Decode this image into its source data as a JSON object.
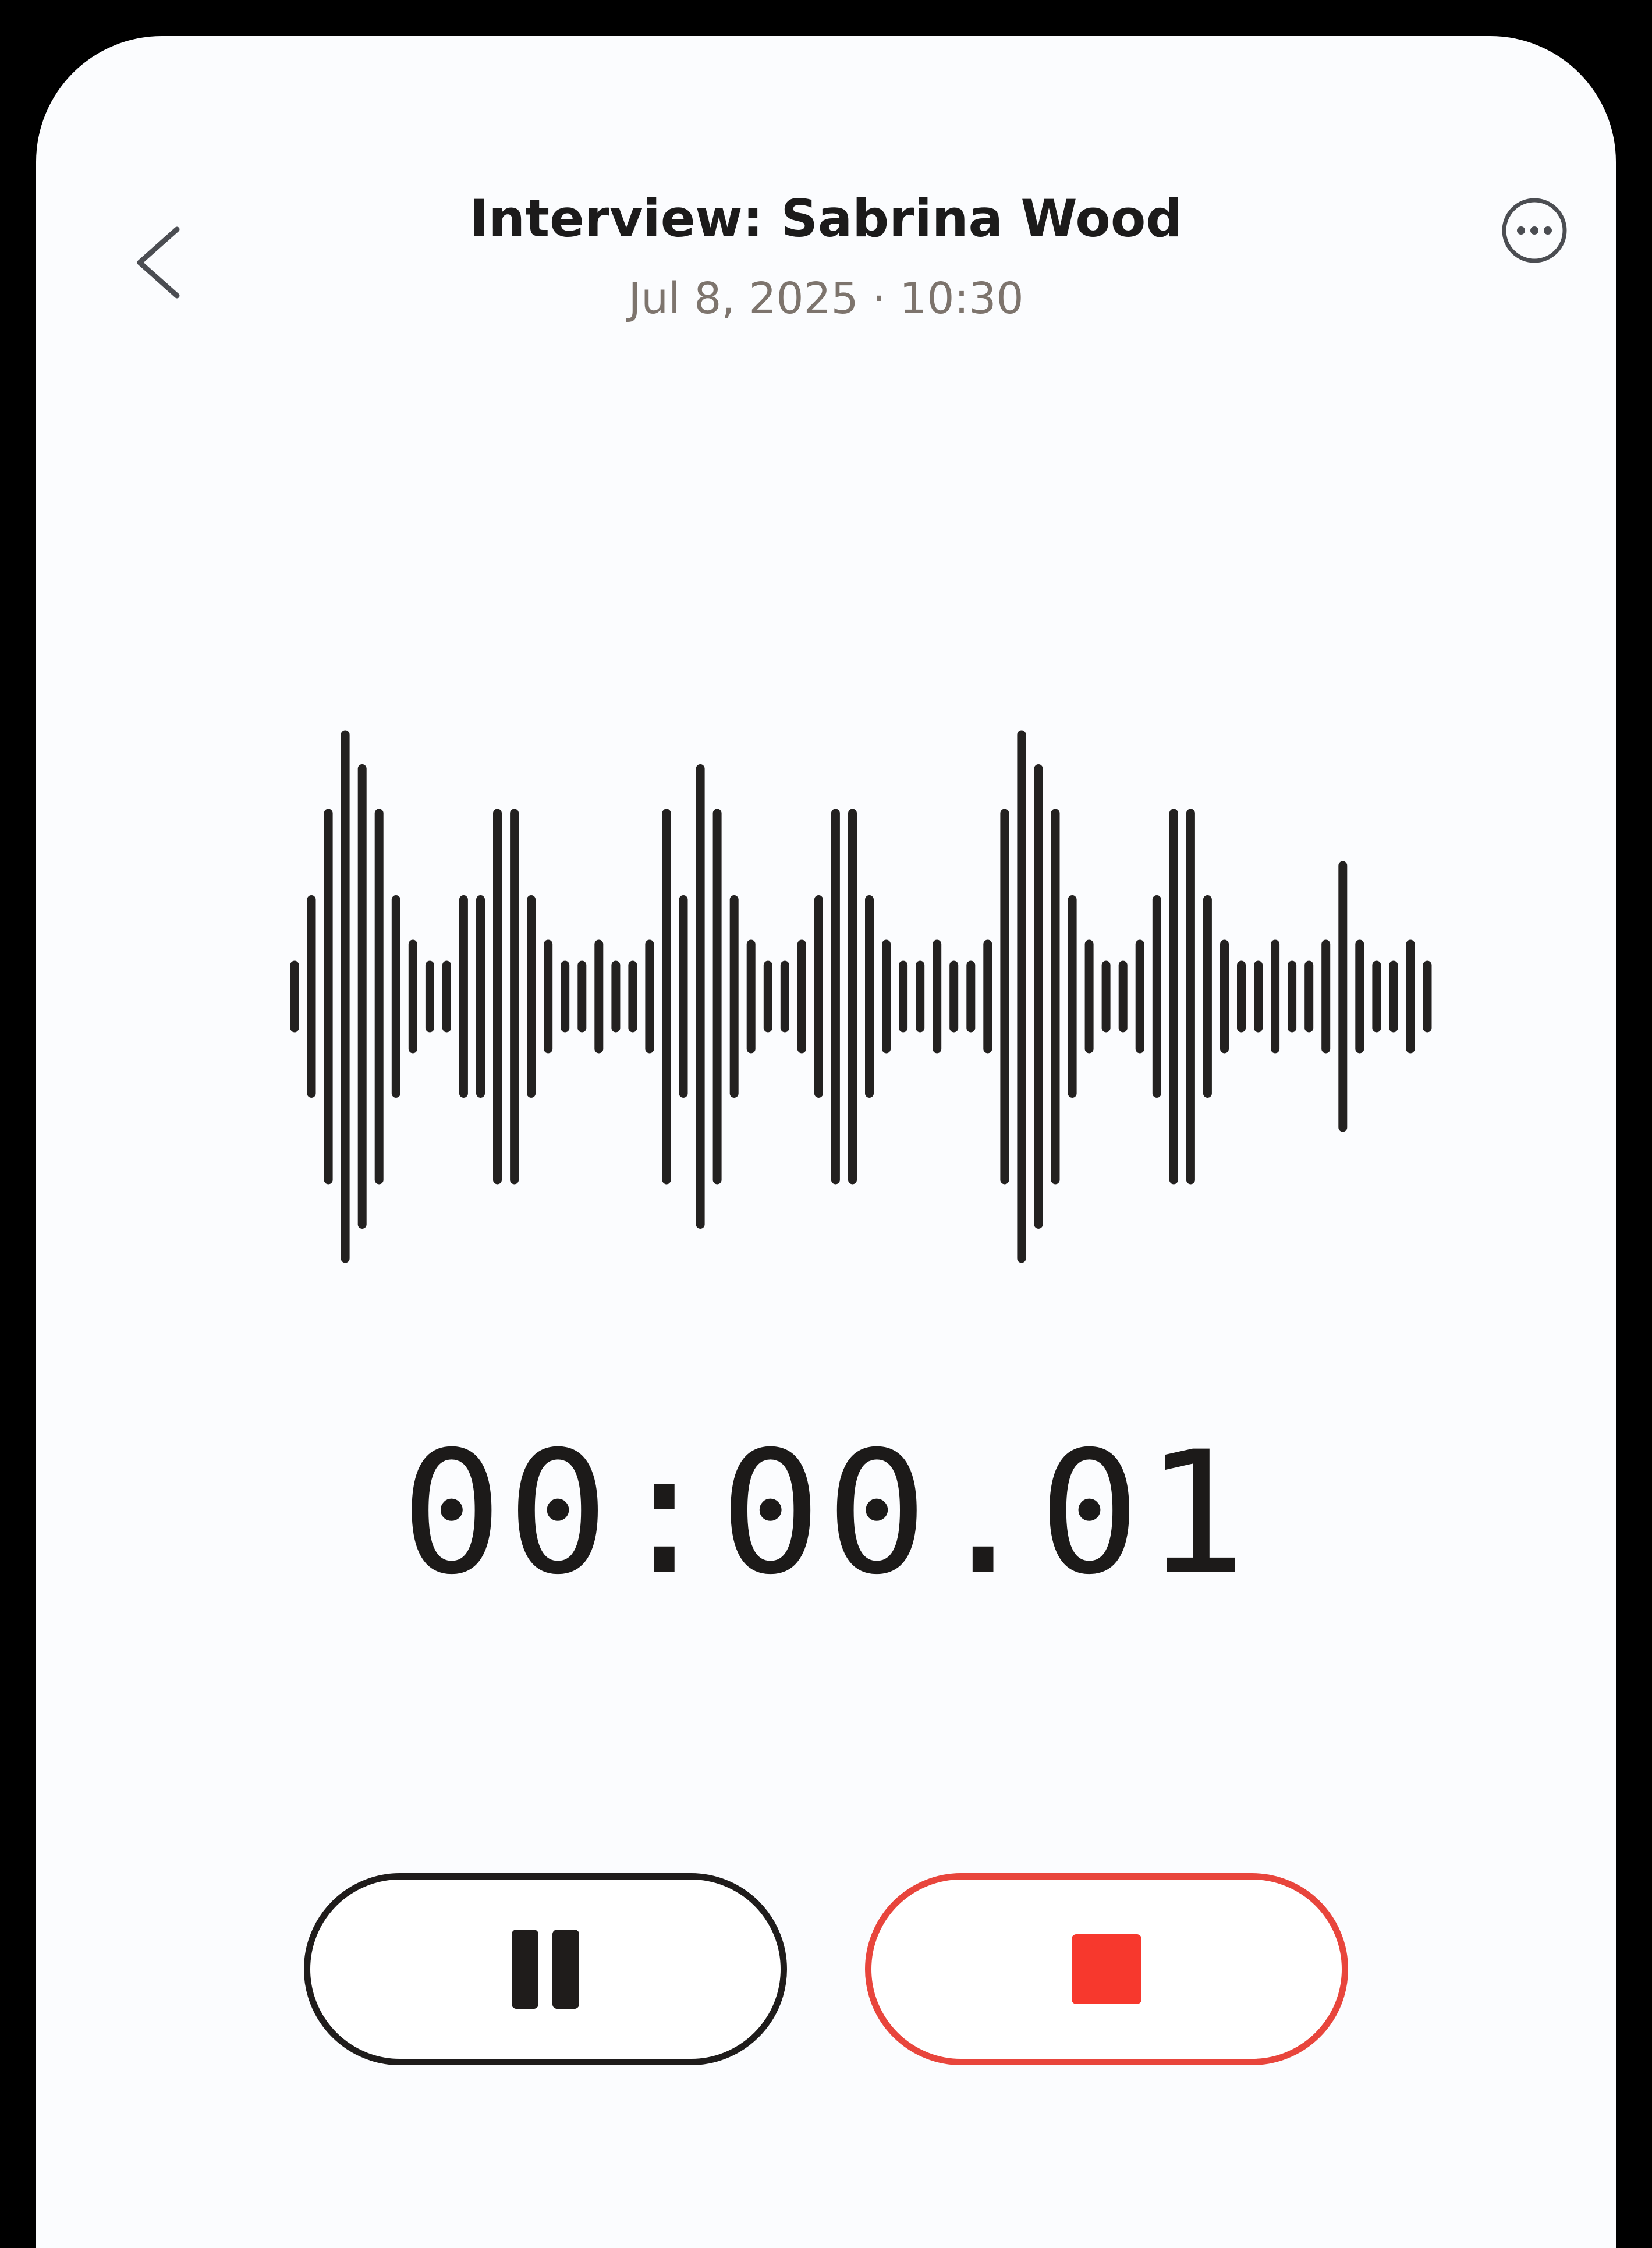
{
  "header": {
    "back_icon": "chevron-left-icon",
    "title": "Interview: Sabrina Wood",
    "subtitle": "Jul 8, 2025 · 10:30",
    "more_icon": "ellipsis-circle-icon"
  },
  "recording": {
    "elapsed": "00:00.01",
    "waveform_levels": [
      0.12,
      0.37,
      0.7,
      1.0,
      0.87,
      0.7,
      0.37,
      0.2,
      0.12,
      0.12,
      0.37,
      0.37,
      0.7,
      0.7,
      0.37,
      0.2,
      0.12,
      0.12,
      0.2,
      0.12,
      0.12,
      0.2,
      0.7,
      0.37,
      0.87,
      0.7,
      0.37,
      0.2,
      0.12,
      0.12,
      0.2,
      0.37,
      0.7,
      0.7,
      0.37,
      0.2,
      0.12,
      0.12,
      0.2,
      0.12,
      0.12,
      0.2,
      0.7,
      1.0,
      0.87,
      0.7,
      0.37,
      0.2,
      0.12,
      0.12,
      0.2,
      0.37,
      0.7,
      0.7,
      0.37,
      0.2,
      0.12,
      0.12,
      0.2,
      0.12,
      0.12,
      0.2,
      0.5,
      0.2,
      0.12,
      0.12,
      0.2,
      0.12
    ]
  },
  "controls": {
    "pause_icon": "pause-icon",
    "stop_icon": "stop-icon"
  },
  "colors": {
    "background": "#fbfcfe",
    "waveform": "#232120",
    "text_primary": "#1c1b1b",
    "text_secondary": "#7d746d",
    "stop_accent": "#e8453c",
    "stop_fill": "#f7382d"
  }
}
